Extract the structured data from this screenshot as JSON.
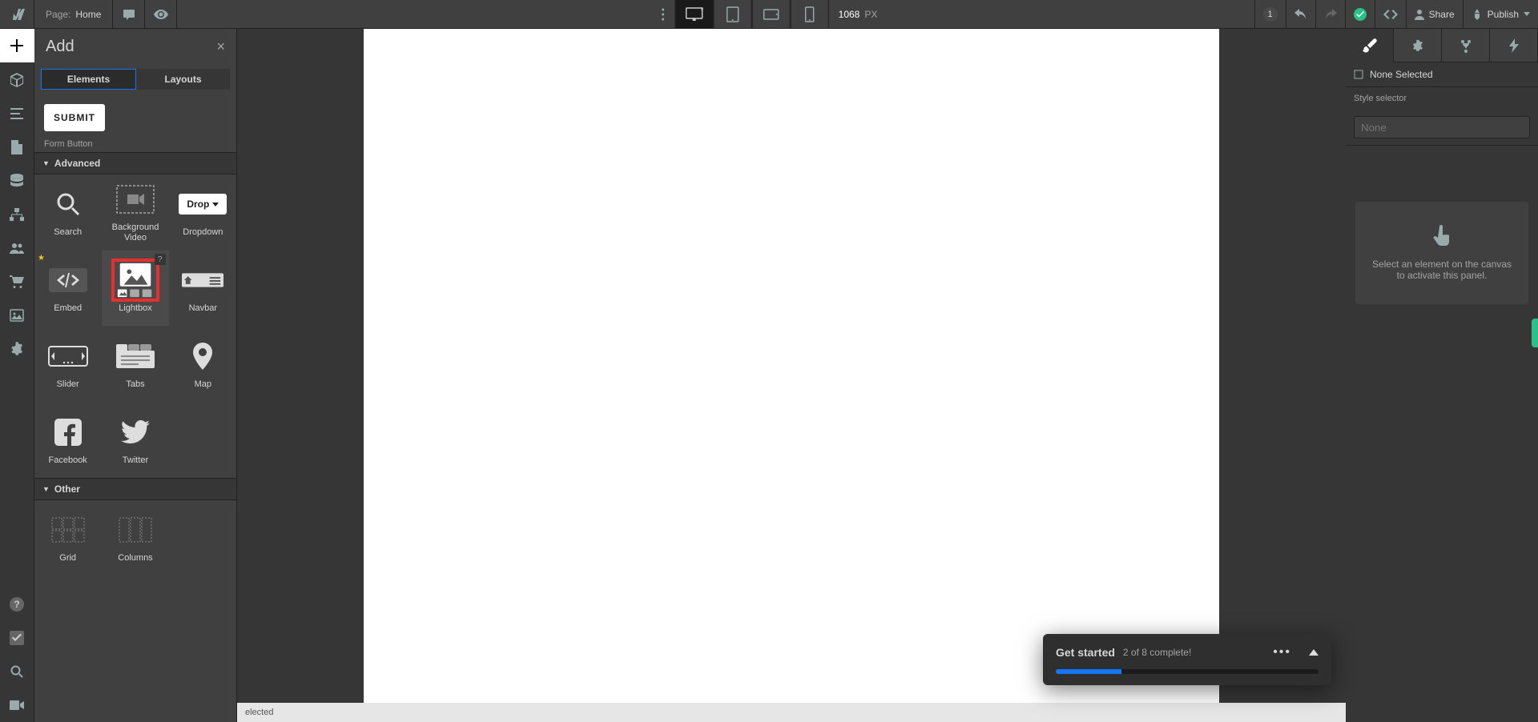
{
  "topbar": {
    "page_label": "Page:",
    "page_name": "Home",
    "width_value": "1068",
    "width_unit": "PX",
    "changes": "1",
    "share": "Share",
    "publish": "Publish"
  },
  "addpanel": {
    "title": "Add",
    "tabs": {
      "elements": "Elements",
      "layouts": "Layouts"
    },
    "submit_btn": "SUBMIT",
    "submit_label": "Form Button",
    "sections": {
      "advanced": "Advanced",
      "other": "Other"
    },
    "tiles": {
      "search": "Search",
      "bgvideo": "Background\nVideo",
      "dropdown": "Dropdown",
      "drop": "Drop",
      "embed": "Embed",
      "lightbox": "Lightbox",
      "navbar": "Navbar",
      "slider": "Slider",
      "tabs": "Tabs",
      "map": "Map",
      "facebook": "Facebook",
      "twitter": "Twitter",
      "grid": "Grid",
      "columns": "Columns"
    }
  },
  "rightpanel": {
    "none_selected": "None Selected",
    "style_selector": "Style selector",
    "selector_placeholder": "None",
    "hint": "Select an element on the canvas to activate this panel."
  },
  "statusbar": {
    "text": "elected"
  },
  "toast": {
    "title": "Get started",
    "subtitle": "2 of 8 complete!",
    "progress_pct": 25
  }
}
